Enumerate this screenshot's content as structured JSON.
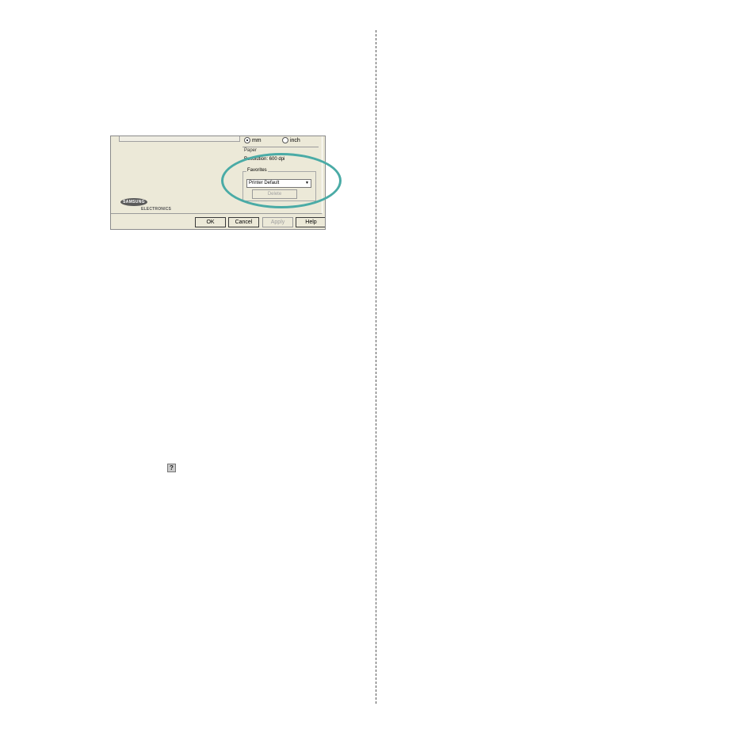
{
  "dialog": {
    "units": {
      "mm_label": "mm",
      "inch_label": "inch",
      "selected": "mm"
    },
    "info": {
      "paper_label": "Paper",
      "resolution_text": "Resolution: 600 dpi"
    },
    "favorites": {
      "group_label": "Favorites",
      "selected_value": "Printer Default",
      "delete_label": "Delete"
    },
    "logo": {
      "brand": "SAMSUNG",
      "sub": "ELECTRONICS"
    },
    "buttons": {
      "ok": "OK",
      "cancel": "Cancel",
      "apply": "Apply",
      "help": "Help"
    }
  },
  "icons": {
    "dropdown": "chevron-down-icon",
    "help": "question-mark-icon"
  },
  "colors": {
    "highlight": "#4aaba6",
    "dialog_bg": "#ece9d8"
  }
}
